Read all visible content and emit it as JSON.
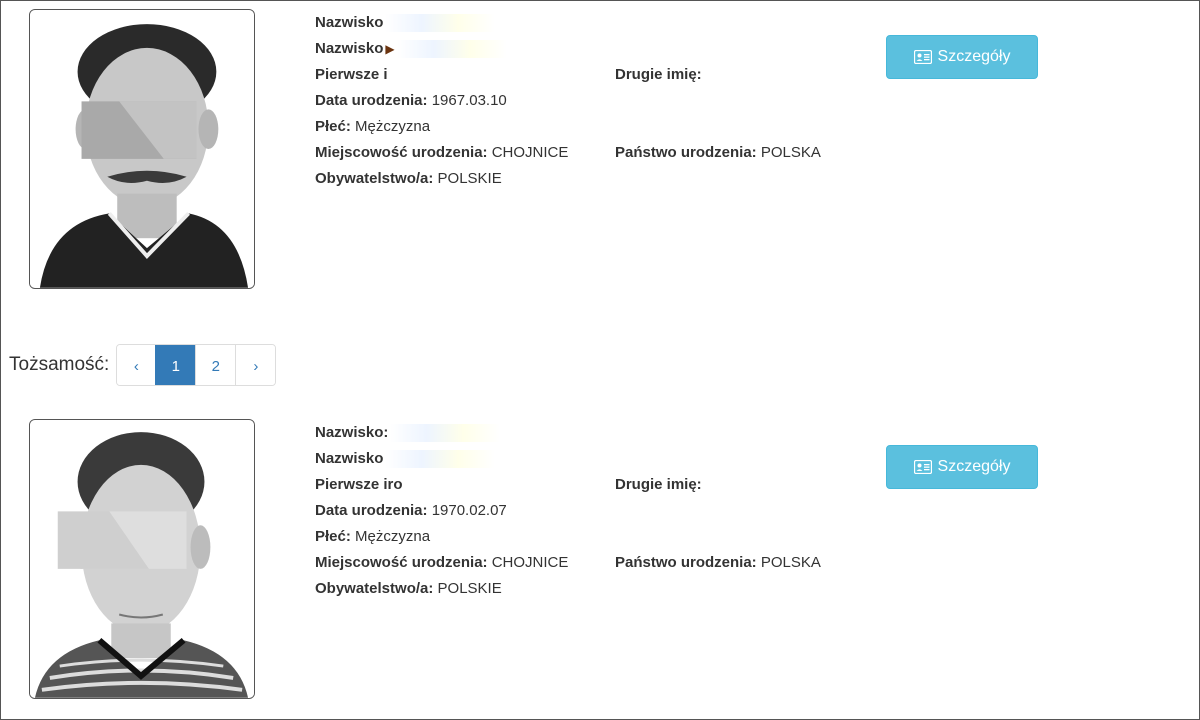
{
  "records": [
    {
      "surname_label": "Nazwisko",
      "surname2_label": "Nazwisko",
      "first_name_label": "Pierwsze i",
      "second_name_label": "Drugie imię:",
      "birth_date_label": "Data urodzenia:",
      "birth_date": "1967.03.10",
      "sex_label": "Płeć:",
      "sex": "Mężczyzna",
      "birth_place_label": "Miejscowość urodzenia:",
      "birth_place": "CHOJNICE",
      "birth_country_label": "Państwo urodzenia:",
      "birth_country": "POLSKA",
      "citizenship_label": "Obywatelstwo/a:",
      "citizenship": "POLSKIE",
      "details_label": "Szczegóły"
    },
    {
      "surname_label": "Nazwisko:",
      "surname2_label": "Nazwisko",
      "first_name_label": "Pierwsze iro",
      "second_name_label": "Drugie imię:",
      "birth_date_label": "Data urodzenia:",
      "birth_date": "1970.02.07",
      "sex_label": "Płeć:",
      "sex": "Mężczyzna",
      "birth_place_label": "Miejscowość urodzenia:",
      "birth_place": "CHOJNICE",
      "birth_country_label": "Państwo urodzenia:",
      "birth_country": "POLSKA",
      "citizenship_label": "Obywatelstwo/a:",
      "citizenship": "POLSKIE",
      "details_label": "Szczegóły"
    }
  ],
  "pagination": {
    "label": "Tożsamość:",
    "prev": "‹",
    "pages": [
      "1",
      "2"
    ],
    "next": "›",
    "current": "1"
  },
  "icons": {
    "details": "id-card-icon"
  },
  "colors": {
    "details_button": "#5bc0de",
    "active_page": "#337ab7"
  }
}
